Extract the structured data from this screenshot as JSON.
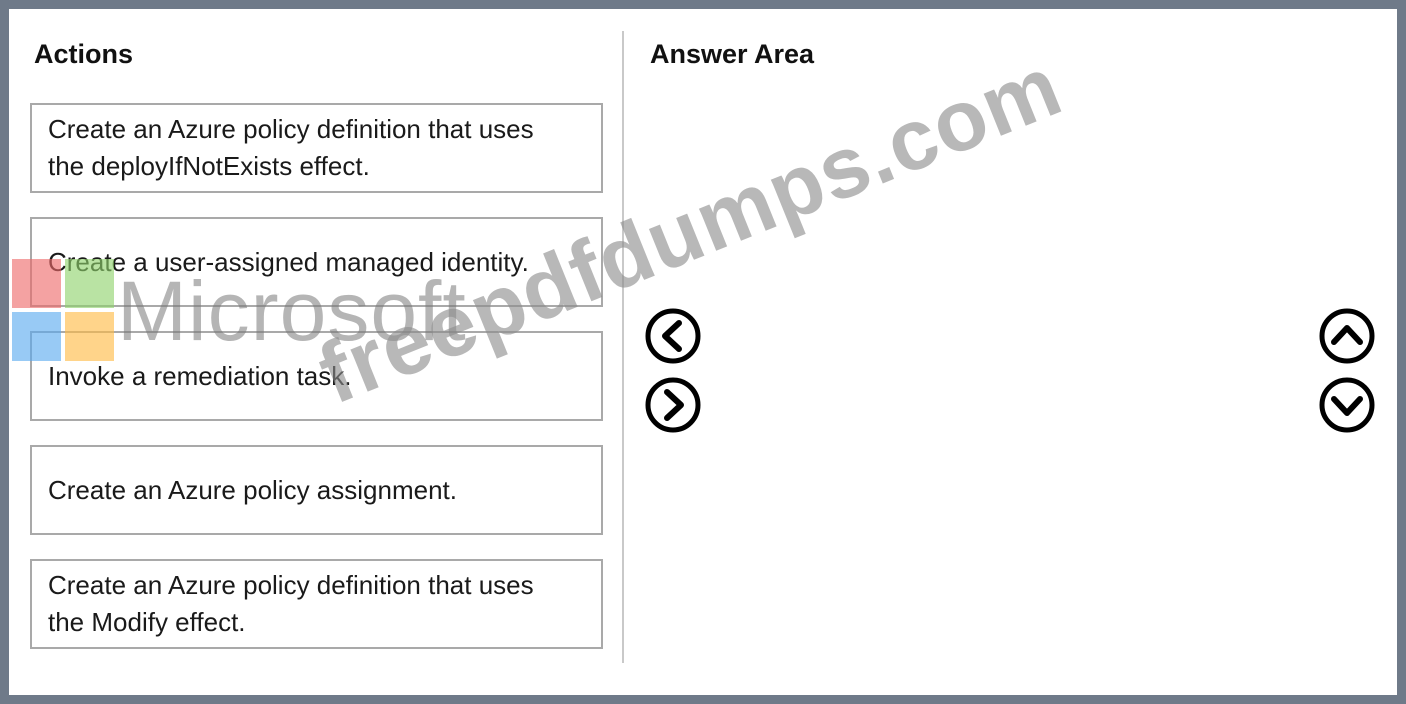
{
  "actions": {
    "heading": "Actions",
    "items": [
      {
        "line1": "Create an Azure policy definition that uses",
        "line2": "the deployIfNotExists effect."
      },
      {
        "line1": "Create a user-assigned managed identity.",
        "line2": ""
      },
      {
        "line1": "Invoke a remediation task.",
        "line2": ""
      },
      {
        "line1": "Create an Azure policy assignment.",
        "line2": ""
      },
      {
        "line1": "Create an Azure policy definition that uses",
        "line2": "the Modify effect."
      }
    ]
  },
  "answer_area": {
    "heading": "Answer Area"
  },
  "controls": {
    "move_left_icon": "chevron-left-circle",
    "move_right_icon": "chevron-right-circle",
    "move_up_icon": "chevron-up-circle",
    "move_down_icon": "chevron-down-circle"
  },
  "watermarks": {
    "logo_text": "Microsoft",
    "site_text": "freepdfdumps.com"
  },
  "colors": {
    "frame_border": "#6f7a89",
    "box_border": "#a9a9a9",
    "divider": "#c9c9c9"
  }
}
